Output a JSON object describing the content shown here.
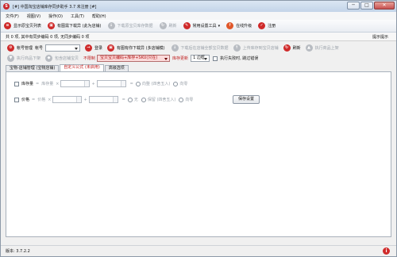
{
  "window": {
    "title": "[#] 中国淘宝店铺库存同步助手 3.7 未注册 [#]",
    "icon_glyph": "S",
    "controls": {
      "minimize": "─",
      "maximize": "□",
      "close": "✕"
    }
  },
  "menu": [
    "文件(F)",
    "视图(V)",
    "操作(O)",
    "工具(T)",
    "帮助(H)"
  ],
  "toolbar": [
    {
      "label": "显示原宝贝列表",
      "icon": "list-icon",
      "glyph": "≡",
      "color": "red",
      "enabled": true
    },
    {
      "label": "有图需下载异 (此为店铺)",
      "icon": "image-icon",
      "glyph": "▣",
      "color": "red",
      "enabled": true
    },
    {
      "label": "下载原宝贝库存数据",
      "icon": "download-icon",
      "glyph": "↓",
      "color": "grey",
      "enabled": false
    },
    {
      "label": "刷新",
      "icon": "refresh-icon",
      "glyph": "↻",
      "color": "grey",
      "enabled": false
    },
    {
      "label": "常用设置工具",
      "icon": "wrench-icon",
      "glyph": "✎",
      "color": "red",
      "enabled": true,
      "dropdown": true
    },
    {
      "label": "在线升级",
      "icon": "upgrade-icon",
      "glyph": "↑",
      "color": "red",
      "enabled": true
    },
    {
      "label": "注册",
      "icon": "register-icon",
      "glyph": "✓",
      "color": "red",
      "enabled": true
    }
  ],
  "infobar": {
    "text": "共 0 项, 其中有同步编码 0 项, 无同步编码 0 项",
    "right": "提示提示"
  },
  "account": {
    "manage_label": "帐号管理",
    "account_label": "帐号",
    "login": "登录",
    "view_download": "有图有你下载异 (多店铺模)",
    "download_all": "下载后在店铺全部宝贝数据",
    "upload": "上传库存到宝贝店铺",
    "refresh": "刷新",
    "execute_listing": "执行商品上架"
  },
  "row3": {
    "execute_delist": "执行商品下架",
    "select_shop": "包含店铺宝贝",
    "note_red": "不限制",
    "red_select": "宝贝宝贝编码+库存+SKU(只在)",
    "sort_label": "库存更新",
    "count_select": "1 边框",
    "auto_check": "执行失败时, 跳过错误"
  },
  "tabs": [
    "宝物-店铺管理 (宝物店铺)",
    "自定义公式 (未启用)",
    "高级选项"
  ],
  "active_tab": 1,
  "panel": {
    "row1": {
      "check_label": "库存量",
      "op": "库存量",
      "x": "×",
      "plus": "+",
      "radio_a": "向整 (四舍五入)",
      "radio_b": "向零"
    },
    "row2": {
      "check_label": "价格",
      "op": "价格",
      "x": "×",
      "plus": "+",
      "radio_zero": "无",
      "radio_a": "保留 (四舍五入)",
      "radio_b": "向零"
    },
    "save": "保存设置"
  },
  "statusbar": {
    "version": "版本: 3.7.2.2",
    "info_glyph": "i"
  }
}
